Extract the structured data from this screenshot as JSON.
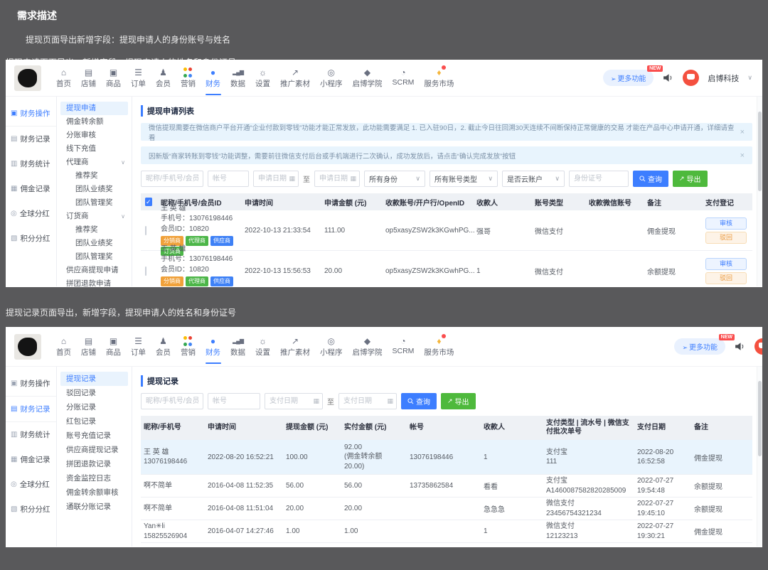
{
  "page": {
    "heading": "需求描述",
    "sub1": "提现页面导出新增字段：提现申请人的身份账号与姓名",
    "sub2": "提现申请页面导出，新增字段，提现申请人的姓名和身份证号",
    "sub3": "提现记录页面导出，新增字段，提现申请人的姓名和身份证号"
  },
  "colors": {
    "accent_blue": "#3d7eff",
    "green_button": "#4eb93c",
    "notice_bg": "#e8f4fd",
    "badge_orange": "#f0a13a",
    "badge_green": "#4cb648",
    "badge_blue": "#3e81f6",
    "new_badge_red": "#fa4e4e",
    "active_menu_bg": "#e9f3fd",
    "table_header_bg": "#eef1f5"
  },
  "topbar": {
    "nav": [
      {
        "label": "首页",
        "glyph": "⌂"
      },
      {
        "label": "店铺",
        "glyph": "▤"
      },
      {
        "label": "商品",
        "glyph": "▣"
      },
      {
        "label": "订单",
        "glyph": "☰"
      },
      {
        "label": "会员",
        "glyph": "♟"
      },
      {
        "label": "营销",
        "glyph": ""
      },
      {
        "label": "财务",
        "glyph": "●"
      },
      {
        "label": "数据",
        "glyph": "▂▄▆"
      },
      {
        "label": "设置",
        "glyph": "☼"
      },
      {
        "label": "推广素材",
        "glyph": "↗"
      },
      {
        "label": "小程序",
        "glyph": "◎"
      },
      {
        "label": "启博学院",
        "glyph": "◆"
      },
      {
        "label": "SCRM",
        "glyph": "◔"
      },
      {
        "label": "服务市场",
        "glyph": "♦"
      }
    ],
    "active": "财务",
    "more_label": "更多功能",
    "new_badge": "NEW",
    "company": "启博科技",
    "chevron": "∨"
  },
  "sidebar1": {
    "items": [
      {
        "label": "财务操作",
        "glyph": "▣"
      },
      {
        "label": "财务记录",
        "glyph": "▤"
      },
      {
        "label": "财务统计",
        "glyph": "▥"
      },
      {
        "label": "佣金记录",
        "glyph": "▦"
      },
      {
        "label": "全球分红",
        "glyph": "◎"
      },
      {
        "label": "积分分红",
        "glyph": "▧"
      }
    ]
  },
  "shot1": {
    "menu": [
      "提现申请",
      "佣金转余额",
      "分账审核",
      "线下充值",
      "代理商",
      "推荐奖",
      "团队业绩奖",
      "团队管理奖",
      "订货商",
      "推荐奖",
      "团队业绩奖",
      "团队管理奖",
      "供应商提现申请",
      "拼团退款申请"
    ],
    "group_chevron": "∨",
    "title": "提现申请列表",
    "notices": [
      "微信提现需要在微信商户平台开通“企业付款到零钱”功能才能正常发放，此功能需要满足 1. 已入驻90日，2. 截止今日往回溯30天连续不间断保持正常健康的交易 才能在产品中心申请开通，详细请查看",
      "因新版“商家转账到零钱”功能调整，需要前往微信支付后台或手机端进行二次确认，成功发放后，请点击“确认完成发放”按钮"
    ],
    "close_x": "×",
    "filters": {
      "kw_ph": "昵称/手机号/会员ID",
      "account_ph": "帐号",
      "date_ph": "申请日期",
      "to": "至",
      "sel_identity": "所有身份",
      "sel_account_type": "所有账号类型",
      "sel_cloud": "是否云账户",
      "id_ph": "身份证号",
      "search": "查询",
      "export": "导出"
    },
    "table": {
      "headers": [
        "昵称/手机号/会员ID",
        "申请时间",
        "申请金额 (元)",
        "收款账号/开户行/OpenID",
        "收款人",
        "账号类型",
        "收款微信账号",
        "备注",
        "支付登记"
      ],
      "badges": [
        "分销商",
        "代理商",
        "供应商",
        "订货商"
      ],
      "actions": {
        "audit": "审核",
        "reject": "驳回"
      },
      "rows": [
        {
          "name": "王 英 雄",
          "phone": "手机号：13076198446",
          "member": "会员ID：10820",
          "time": "2022-10-13 21:33:54",
          "amount": "111.00",
          "account": "op5xasyZSW2k3KGwhPG...",
          "payee": "强哥",
          "type": "微信支付",
          "wechat": "",
          "note": "佣金提现"
        },
        {
          "name": "王 英 雄",
          "phone": "手机号：13076198446",
          "member": "会员ID：10820",
          "time": "2022-10-13 15:56:53",
          "amount": "20.00",
          "account": "op5xasyZSW2k3KGwhPG...",
          "payee": "1",
          "type": "微信支付",
          "wechat": "",
          "note": "余额提现"
        }
      ]
    }
  },
  "shot2": {
    "menu": [
      "提现记录",
      "驳回记录",
      "分账记录",
      "红包记录",
      "账号充值记录",
      "供应商提现记录",
      "拼团退款记录",
      "资金监控日志",
      "佣金转余额审核",
      "通联分账记录"
    ],
    "title": "提现记录",
    "filters": {
      "kw_ph": "昵称/手机号/会员ID",
      "account_ph": "帐号",
      "date_ph": "支付日期",
      "to": "至",
      "search": "查询",
      "export": "导出"
    },
    "table": {
      "headers": [
        "昵称/手机号",
        "申请时间",
        "提现金额 (元)",
        "实付金额 (元)",
        "帐号",
        "收款人",
        "支付类型 | 流水号 | 微信支付批次单号",
        "支付日期",
        "备注"
      ],
      "rows": [
        {
          "name": "王 英 雄\n13076198446",
          "time": "2022-08-20 16:52:21",
          "amount": "100.00",
          "actual": "92.00\n(佣金转余额\n20.00)",
          "account": "13076198446",
          "payee": "1",
          "paytype": "支付宝\n111",
          "paydate": "2022-08-20\n16:52:58",
          "note": "佣金提现"
        },
        {
          "name": "啊不简单",
          "time": "2016-04-08 11:52:35",
          "amount": "56.00",
          "actual": "56.00",
          "account": "13735862584",
          "payee": "看看",
          "paytype": "支付宝\nA1460087582820285009",
          "paydate": "2022-07-27\n19:54:48",
          "note": "余额提现"
        },
        {
          "name": "啊不简单",
          "time": "2016-04-08 11:51:04",
          "amount": "20.00",
          "actual": "20.00",
          "account": "",
          "payee": "急急急",
          "paytype": "微信支付\n23456754321234",
          "paydate": "2022-07-27\n19:45:10",
          "note": "余额提现"
        },
        {
          "name": "Yan✳li\n15825526904",
          "time": "2016-04-07 14:27:46",
          "amount": "1.00",
          "actual": "1.00",
          "account": "",
          "payee": "1",
          "paytype": "微信支付\n12123213",
          "paydate": "2022-07-27\n19:30:21",
          "note": "佣金提现"
        }
      ]
    }
  }
}
